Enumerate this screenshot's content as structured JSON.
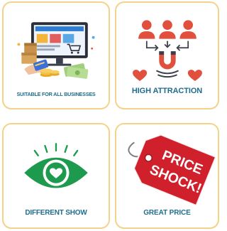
{
  "cards": [
    {
      "label": "SUITABLE FOR ALL BUSINESSES",
      "icon": "ecommerce-laptop-icon"
    },
    {
      "label": "HIGH ATTRACTION",
      "icon": "magnet-attraction-icon"
    },
    {
      "label": "DIFFERENT SHOW",
      "icon": "eye-heart-icon"
    },
    {
      "label": "GREAT PRICE",
      "icon": "price-tag-icon",
      "tag_lines": [
        "PRICE",
        "SHOCK!"
      ]
    }
  ],
  "colors": {
    "card_border": "#f5d28a",
    "label_text": "#1f6d8e",
    "attraction_red": "#e0503c",
    "eye_green": "#1e9a4e",
    "tag_red": "#d0202b"
  }
}
